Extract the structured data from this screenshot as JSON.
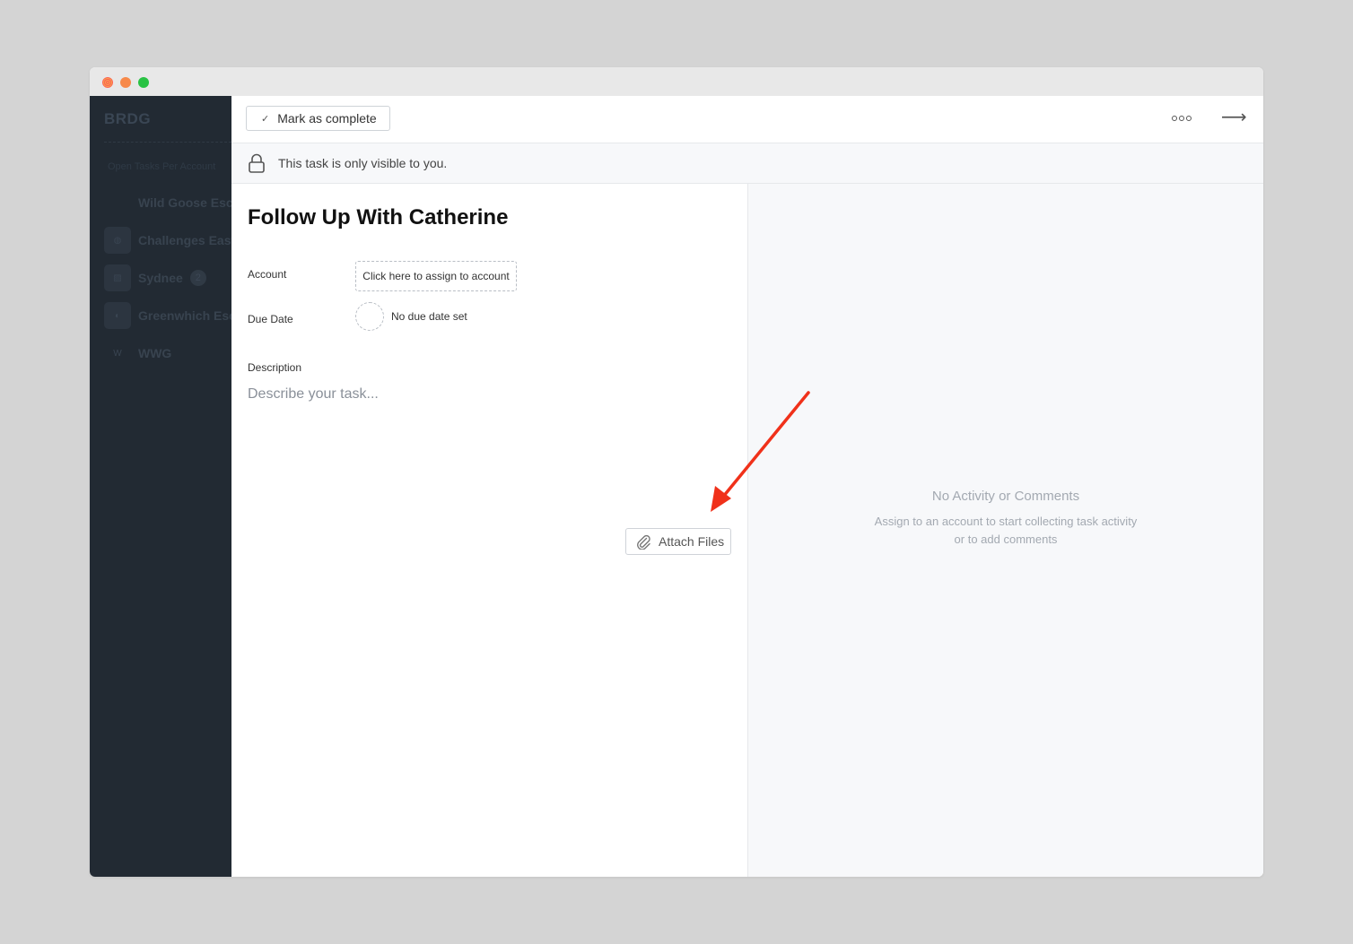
{
  "window": {
    "controls": [
      "close",
      "minimize",
      "maximize"
    ]
  },
  "sidebar": {
    "brand": "BRDG",
    "section_title": "Open Tasks Per Account",
    "items": [
      {
        "label": "Wild Goose Escape",
        "badge": ""
      },
      {
        "label": "Challenges East L",
        "badge": ""
      },
      {
        "label": "Sydnee",
        "badge": "2"
      },
      {
        "label": "Greenwhich Escape",
        "badge": ""
      },
      {
        "label": "WWG",
        "badge": "",
        "avatar_text": "W"
      }
    ]
  },
  "toolbar": {
    "mark_complete_label": "Mark as complete",
    "more_icon": "more-icon",
    "close_panel_icon": "arrow-right-icon"
  },
  "notice": {
    "text": "This task is only visible to you.",
    "icon": "lock-icon"
  },
  "task": {
    "title": "Follow Up With Catherine",
    "account_label": "Account",
    "account_button": "Click here to assign to account",
    "due_date_label": "Due Date",
    "due_date_value": "No due date set",
    "description_label": "Description",
    "description_placeholder": "Describe your task...",
    "attach_label": "Attach Files"
  },
  "activity": {
    "empty_title": "No Activity or Comments",
    "empty_subtitle": "Assign to an account to start collecting task activity or to add comments"
  },
  "colors": {
    "sidebar_bg": "#222a33",
    "annotation_arrow": "#f0311a",
    "panel_bg": "#f7f8fa"
  }
}
